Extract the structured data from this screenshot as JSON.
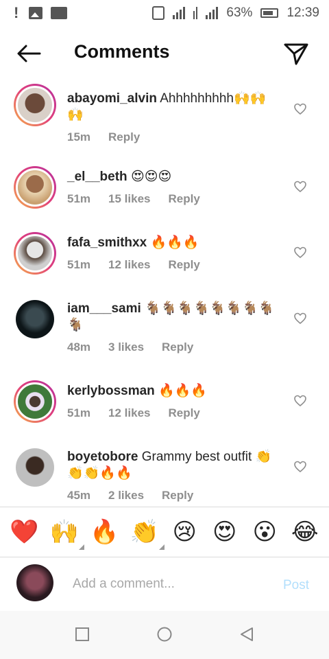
{
  "status_bar": {
    "battery_percent": "63%",
    "time": "12:39",
    "icons": [
      "alert-icon",
      "image-icon",
      "pulse-icon",
      "vibrate-icon",
      "signal-icon",
      "data-icon",
      "signal-icon",
      "battery-icon"
    ]
  },
  "header": {
    "title": "Comments",
    "back_icon": "arrow-left-icon",
    "send_icon": "paper-plane-icon"
  },
  "comments": [
    {
      "username": "abayomi_alvin",
      "text": "Ahhhhhhhhh🙌🙌🙌",
      "time": "15m",
      "likes": "",
      "reply": "Reply",
      "has_story_ring": true
    },
    {
      "username": "_el__beth",
      "text": "😍😍😍",
      "time": "51m",
      "likes": "15 likes",
      "reply": "Reply",
      "has_story_ring": true
    },
    {
      "username": "fafa_smithxx",
      "text": "🔥🔥🔥",
      "time": "51m",
      "likes": "12 likes",
      "reply": "Reply",
      "has_story_ring": true
    },
    {
      "username": "iam___sami",
      "text": "🐐🐐🐐🐐🐐🐐🐐🐐🐐",
      "time": "48m",
      "likes": "3 likes",
      "reply": "Reply",
      "has_story_ring": false
    },
    {
      "username": "kerlybossman",
      "text": "🔥🔥🔥",
      "time": "51m",
      "likes": "12 likes",
      "reply": "Reply",
      "has_story_ring": true
    },
    {
      "username": "boyetobore",
      "text": "Grammy best outfit 👏👏👏🔥🔥",
      "time": "45m",
      "likes": "2 likes",
      "reply": "Reply",
      "has_story_ring": false
    }
  ],
  "emoji_bar": [
    "❤️",
    "🙌",
    "🔥",
    "👏",
    "😢",
    "😍",
    "😮",
    "😂"
  ],
  "composer": {
    "placeholder": "Add a comment...",
    "post_label": "Post"
  },
  "colors": {
    "post_disabled": "#b2dffc",
    "meta_gray": "#8e8e8e",
    "story_ring": [
      "#f6b44a",
      "#e2407a"
    ]
  }
}
